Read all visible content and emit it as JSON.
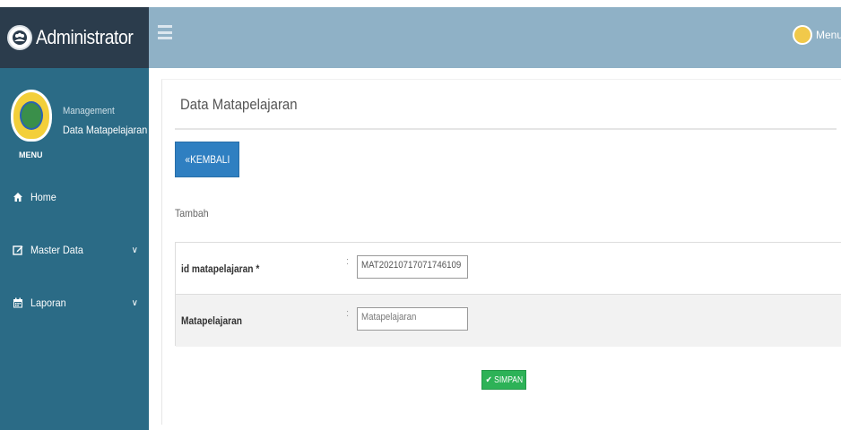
{
  "app": {
    "brand_title": "Administrator",
    "user_menu_label": "Menu"
  },
  "sidebar": {
    "profile": {
      "management_label": "Management",
      "current_page": "Data Matapelajaran",
      "menu_label": "MENU"
    },
    "items": [
      {
        "label": "Home",
        "icon": "home-icon"
      },
      {
        "label": "Master Data",
        "icon": "edit-icon",
        "has_submenu": true
      },
      {
        "label": "Laporan",
        "icon": "calendar-icon",
        "has_submenu": true
      }
    ]
  },
  "main": {
    "title": "Data Matapelajaran",
    "back_button": "KEMBALI",
    "form_mode": "Tambah",
    "fields": [
      {
        "label": "id matapelajaran *",
        "value": "MAT20210717071746109"
      },
      {
        "label": "Matapelajaran",
        "placeholder": "Matapelajaran"
      }
    ],
    "save_button": "SIMPAN"
  },
  "colors": {
    "brand_bg": "#2b3c4c",
    "topbar_bg": "#8fb1c6",
    "sidebar_bg": "#2b6b86",
    "primary_button": "#2f7fc1",
    "success_button": "#2db257"
  }
}
